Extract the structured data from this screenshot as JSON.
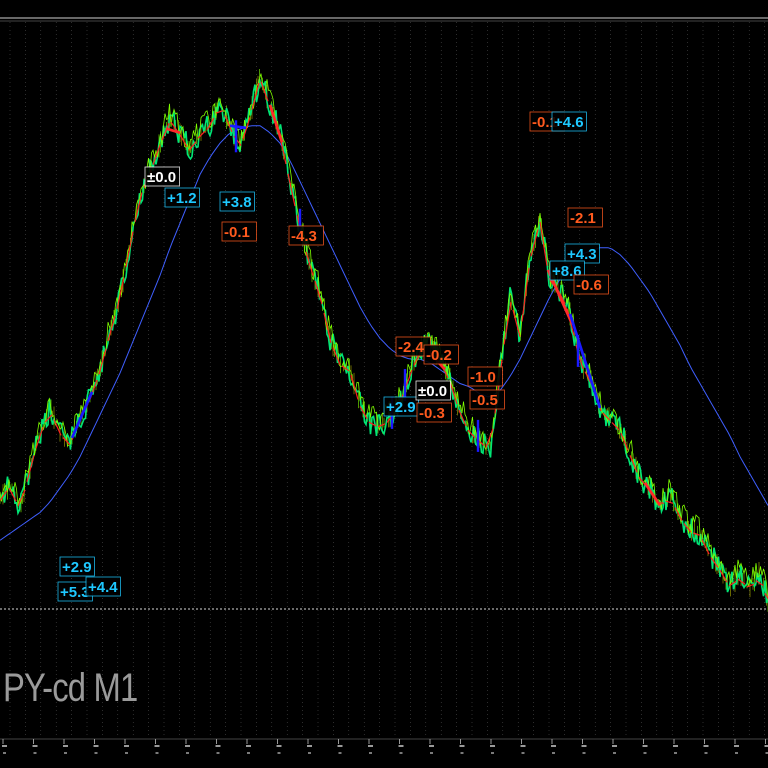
{
  "chart": {
    "symbol_label": "PY-cd M1",
    "colors": {
      "background": "#000000",
      "price_up": "#00e676",
      "price_alt": "#7fff00",
      "ma_fast": "#ff2020",
      "ma_slow": "#3f5fff",
      "bull_segment": "#1a1aff",
      "bear_segment": "#ff2a2a",
      "tag_blue": "#1ec8ff",
      "tag_red": "#ff5a1e",
      "tag_white": "#ffffff",
      "grid": "#5a5a5a"
    }
  },
  "chart_data": {
    "type": "line",
    "title": "",
    "xlabel": "",
    "ylabel": "",
    "grid": true,
    "ylim": [
      0,
      100
    ],
    "x": [
      0,
      10,
      20,
      30,
      40,
      50,
      60,
      70,
      80,
      90,
      100,
      110,
      120,
      130,
      140,
      150,
      160,
      170,
      180,
      190,
      200,
      210,
      220,
      230,
      240,
      250,
      260,
      270,
      280,
      290,
      300,
      310,
      320,
      330,
      340,
      350,
      360,
      370,
      380,
      390,
      400,
      410,
      420,
      430,
      440,
      450,
      460,
      470,
      480,
      490,
      500,
      510,
      520,
      530,
      540,
      550,
      560,
      570,
      580,
      590,
      600,
      610,
      620,
      630,
      640,
      650,
      660,
      670,
      680,
      690,
      700,
      710,
      720,
      730,
      740,
      750,
      760,
      768
    ],
    "series": [
      {
        "values": [
          12,
          16,
          9,
          21,
          31,
          38,
          31,
          28,
          35,
          41,
          49,
          60,
          70,
          85,
          99,
          106,
          114,
          121,
          117,
          112,
          117,
          119,
          126,
          119,
          113,
          122,
          133,
          125,
          117,
          103,
          90,
          79,
          71,
          58,
          51,
          49,
          39,
          34,
          33,
          35,
          40,
          48,
          55,
          57,
          52,
          46,
          37,
          31,
          29,
          26,
          48,
          70,
          59,
          81,
          92,
          74,
          72,
          65,
          51,
          47,
          38,
          35,
          32,
          25,
          18,
          15,
          10,
          13,
          7,
          3,
          2,
          -4,
          -8,
          -13,
          -10,
          -14,
          -9,
          -18
        ]
      },
      {
        "values": [
          0,
          2,
          4,
          6,
          8,
          11,
          15,
          19,
          24,
          30,
          36,
          42,
          48,
          55,
          62,
          69,
          76,
          84,
          91,
          98,
          105,
          110,
          114,
          117,
          118,
          119,
          119,
          117,
          114,
          109,
          103,
          97,
          91,
          85,
          79,
          73,
          67,
          62,
          58,
          55,
          53,
          52,
          52,
          51,
          49,
          47,
          45,
          44,
          42,
          41,
          43,
          47,
          52,
          58,
          64,
          70,
          75,
          79,
          82,
          83,
          84,
          84,
          82,
          79,
          75,
          71,
          66,
          61,
          56,
          50,
          45,
          40,
          35,
          30,
          24,
          19,
          14,
          10
        ]
      }
    ],
    "tags": [
      {
        "text": "±0.0",
        "color": "white"
      },
      {
        "text": "+1.2",
        "color": "blue"
      },
      {
        "text": "+3.8",
        "color": "blue"
      },
      {
        "text": "-0.1",
        "color": "red"
      },
      {
        "text": "-4.3",
        "color": "red"
      },
      {
        "text": "-0.1",
        "color": "red"
      },
      {
        "text": "+4.6",
        "color": "blue"
      },
      {
        "text": "-2.1",
        "color": "red"
      },
      {
        "text": "+4.3",
        "color": "blue"
      },
      {
        "text": "+8.6",
        "color": "blue"
      },
      {
        "text": "-0.6",
        "color": "red"
      },
      {
        "text": "-2.4",
        "color": "red"
      },
      {
        "text": "-0.2",
        "color": "red"
      },
      {
        "text": "+2.9",
        "color": "blue"
      },
      {
        "text": "±0.0",
        "color": "white"
      },
      {
        "text": "-0.3",
        "color": "red"
      },
      {
        "text": "-1.0",
        "color": "red"
      },
      {
        "text": "-0.5",
        "color": "red"
      },
      {
        "text": "+2.9",
        "color": "blue"
      },
      {
        "text": "+5.3",
        "color": "blue"
      },
      {
        "text": "+4.4",
        "color": "blue"
      }
    ]
  }
}
